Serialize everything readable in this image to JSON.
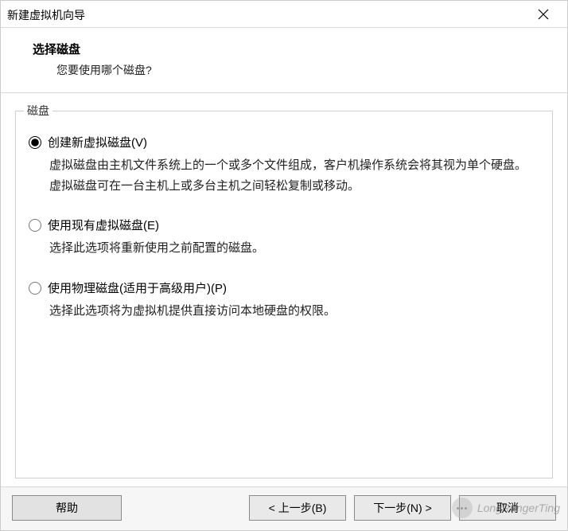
{
  "window": {
    "title": "新建虚拟机向导"
  },
  "header": {
    "heading": "选择磁盘",
    "subheading": "您要使用哪个磁盘?"
  },
  "group": {
    "legend": "磁盘"
  },
  "options": {
    "create": {
      "label": "创建新虚拟磁盘(V)",
      "desc": "虚拟磁盘由主机文件系统上的一个或多个文件组成，客户机操作系统会将其视为单个硬盘。虚拟磁盘可在一台主机上或多台主机之间轻松复制或移动。",
      "selected": true
    },
    "existing": {
      "label": "使用现有虚拟磁盘(E)",
      "desc": "选择此选项将重新使用之前配置的磁盘。",
      "selected": false
    },
    "physical": {
      "label": "使用物理磁盘(适用于高级用户)(P)",
      "desc": "选择此选项将为虚拟机提供直接访问本地硬盘的权限。",
      "selected": false
    }
  },
  "buttons": {
    "help": "帮助",
    "back": "< 上一步(B)",
    "next": "下一步(N) >",
    "cancel": "取消"
  },
  "watermark": {
    "text": "LongRangerTing"
  }
}
